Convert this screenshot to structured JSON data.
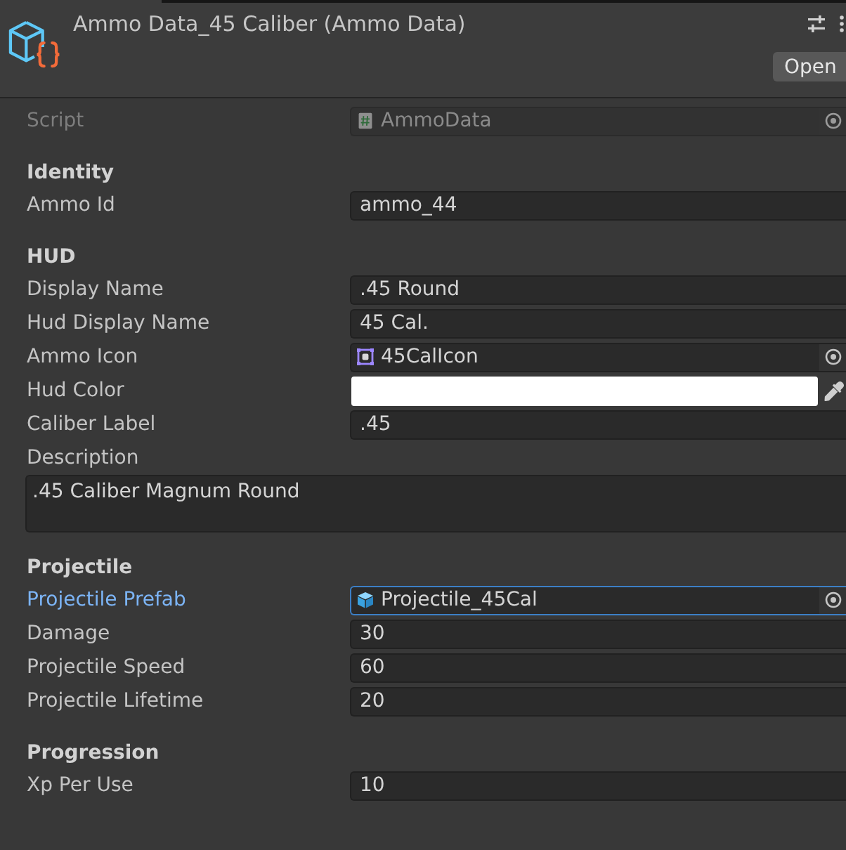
{
  "header": {
    "title": "Ammo Data_45 Caliber (Ammo Data)",
    "open_button": "Open"
  },
  "script_field": {
    "label": "Script",
    "value": "AmmoData",
    "disabled": true
  },
  "sections": [
    {
      "title": "Identity",
      "fields": [
        {
          "kind": "text",
          "label": "Ammo Id",
          "value": "ammo_44",
          "focused": false
        }
      ]
    },
    {
      "title": "HUD",
      "fields": [
        {
          "kind": "text",
          "label": "Display Name",
          "value": ".45 Round",
          "focused": false
        },
        {
          "kind": "text",
          "label": "Hud Display Name",
          "value": "45 Cal.",
          "focused": false
        },
        {
          "kind": "sprite",
          "label": "Ammo Icon",
          "value": "45CalIcon",
          "focused": false
        },
        {
          "kind": "color",
          "label": "Hud Color",
          "color": "#ffffff",
          "focused": false
        },
        {
          "kind": "text",
          "label": "Caliber Label",
          "value": ".45",
          "focused": false
        },
        {
          "kind": "textarea",
          "label": "Description",
          "value": ".45 Caliber Magnum Round",
          "focused": false
        }
      ]
    },
    {
      "title": "Projectile",
      "fields": [
        {
          "kind": "prefab",
          "label": "Projectile Prefab",
          "value": "Projectile_45Cal",
          "focused": true
        },
        {
          "kind": "text",
          "label": "Damage",
          "value": "30",
          "focused": false
        },
        {
          "kind": "text",
          "label": "Projectile Speed",
          "value": "60",
          "focused": false
        },
        {
          "kind": "text",
          "label": "Projectile Lifetime",
          "value": "20",
          "focused": false
        }
      ]
    },
    {
      "title": "Progression",
      "fields": [
        {
          "kind": "text",
          "label": "Xp Per Use",
          "value": "10",
          "focused": false
        }
      ]
    }
  ]
}
